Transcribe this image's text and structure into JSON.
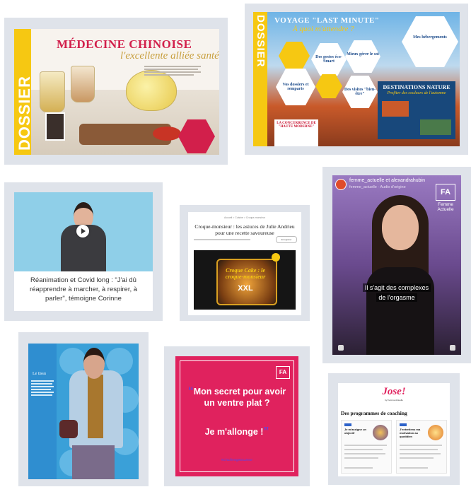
{
  "card_medecine": {
    "dossier": "DOSSIER",
    "title": "MÉDECINE CHINOISE",
    "subtitle": "l'excellente alliée santé"
  },
  "card_voyage": {
    "dossier": "DOSSIER",
    "title": "VOYAGE \"LAST MINUTE\"",
    "subtitle": "À quoi m'attendre ?",
    "hex_labels": [
      "Des gestes éco-Smart",
      "Mieux gérer le sol",
      "Vos dossiers et remparts",
      "Mes hébergements",
      "Des visites \"bien-être\""
    ],
    "destinations_title": "DESTINATIONS NATURE",
    "destinations_sub": "Profiter des couleurs de l'automne",
    "concurrence_title": "LA CONCURRENCE DE \"HAUTE MODERNE\""
  },
  "card_reanimation": {
    "caption": "Réanimation et Covid long : \"J'ai dû réapprendre à marcher, à respirer, à parler\", témoigne Corinne"
  },
  "card_croque": {
    "breadcrumb": "Accueil > Cuisine > Croque-monsieur",
    "title": "Croque-monsieur : les astuces de Julie Andrieu pour une recette savoureuse",
    "bookmark_label": "Enregistrer",
    "overlay_line1": "Croque Cake : le croque-monsieur",
    "overlay_line2": "XXL"
  },
  "card_instagram": {
    "account": "femme_actuelle et alexandrahubin",
    "audio": "femme_actuelle · Audio d'origine",
    "brand_logo": "FA",
    "brand_name": "Femme Actuelle",
    "subtitle_line1": "Il s'agit des complexes",
    "subtitle_line2": "de l'orgasme"
  },
  "card_fashion": {
    "title": "Le tissu"
  },
  "card_quote": {
    "brand_logo": "FA",
    "quote_main": "Mon secret pour avoir un ventre plat ?",
    "quote_answer": "Je m'allonge !",
    "hashtag": "#ChallengeDuJour"
  },
  "card_jose": {
    "logo": "Jose!",
    "logo_sub": "by Femme Actuelle",
    "heading": "Des programmes de coaching",
    "program1_title": "Je m'assigne un objectif",
    "program2_title": "J'entretiens ma motivation au quotidien",
    "colors": {
      "brand_pink": "#e0225e",
      "tag_blue": "#2d62c9"
    }
  },
  "colors": {
    "frame_grey": "#dfe3ea",
    "dossier_yellow": "#f6c812",
    "brand_pink": "#e0225e",
    "voyage_navy": "#18487b",
    "instagram_purple": "#6a4a8e"
  }
}
